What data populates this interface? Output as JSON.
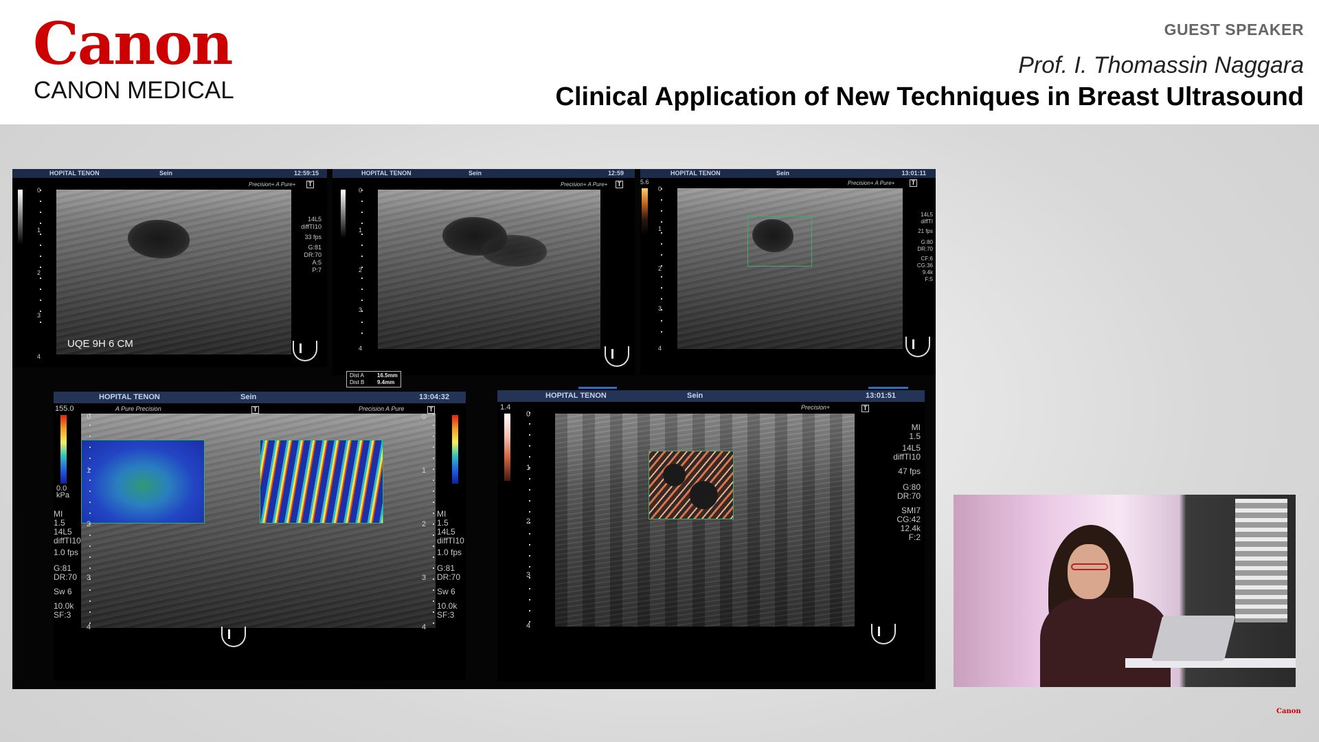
{
  "header": {
    "logo_text": "Canon",
    "logo_subtitle": "CANON MEDICAL",
    "guest_label": "GUEST SPEAKER",
    "speaker": "Prof. I. Thomassin Naggara",
    "title": "Clinical Application of New Techniques in Breast Ultrasound"
  },
  "panels": [
    {
      "hospital": "HOPITAL TENON",
      "exam": "Sein",
      "time": "12:59:15",
      "modes": "Precision+  A Pure+",
      "mode_icon": "T",
      "depth_ticks": [
        "0",
        "1",
        "2",
        "3",
        "4"
      ],
      "params": [
        "14L5",
        "diffTI10",
        "33 fps",
        "G:81",
        "DR:70",
        "A:5",
        "P:7"
      ],
      "annotation": "UQE 9H 6 CM"
    },
    {
      "hospital": "HOPITAL TENON",
      "exam": "Sein",
      "time": "12:59",
      "modes": "Precision+  A Pure+",
      "mode_icon": "T",
      "depth_ticks": [
        "0",
        "1",
        "2",
        "3",
        "4"
      ],
      "measure": [
        {
          "label": "Dist A",
          "value": "16.5mm"
        },
        {
          "label": "Dist B",
          "value": "9.4mm"
        }
      ]
    },
    {
      "hospital": "HOPITAL TENON",
      "exam": "Sein",
      "time": "13:01:11",
      "modes": "Precision+  A Pure+",
      "mode_icon": "T",
      "scale_top": "5.6",
      "depth_ticks": [
        "0",
        "1",
        "2",
        "3",
        "4"
      ],
      "params": [
        "14L5",
        "diffTI",
        "21 fps",
        "G:80",
        "DR:70",
        "CF:6",
        "CG:36",
        "9.4k",
        "F:5"
      ]
    },
    {
      "hospital": "HOPITAL TENON",
      "exam": "Sein",
      "time": "13:04:32",
      "modes_left": "A Pure  Precision",
      "modes_right": "Precision   A Pure",
      "mode_icon": "T",
      "scale_top": "155.0",
      "scale_bottom": "0.0",
      "scale_unit": "kPa",
      "depth_ticks": [
        "0",
        "1",
        "2",
        "3",
        "4"
      ],
      "params_left": [
        "MI",
        "1.5",
        "14L5",
        "diffTI10",
        "1.0 fps",
        "G:81",
        "DR:70",
        "Sw 6",
        "10.0k",
        "SF:3"
      ],
      "params_right": [
        "MI",
        "1.5",
        "14L5",
        "diffTI10",
        "1.0 fps",
        "G:81",
        "DR:70",
        "Sw 6",
        "10.0k",
        "SF:3"
      ]
    },
    {
      "hospital": "HOPITAL TENON",
      "exam": "Sein",
      "time": "13:01:51",
      "modes": "Precision+",
      "mode_icon": "T",
      "scale_top": "1.4",
      "depth_ticks": [
        "0",
        "1",
        "2",
        "3",
        "4"
      ],
      "params": [
        "MI",
        "1.5",
        "14L5",
        "diffTI10",
        "47 fps",
        "G:80",
        "DR:70",
        "SMI7",
        "CG:42",
        "12.4k",
        "F:2"
      ]
    }
  ],
  "corner_logo": "Canon",
  "colors": {
    "canon_red": "#cc0000",
    "header_bar": "#1d2b4a",
    "roi_green": "#3cb06a"
  }
}
